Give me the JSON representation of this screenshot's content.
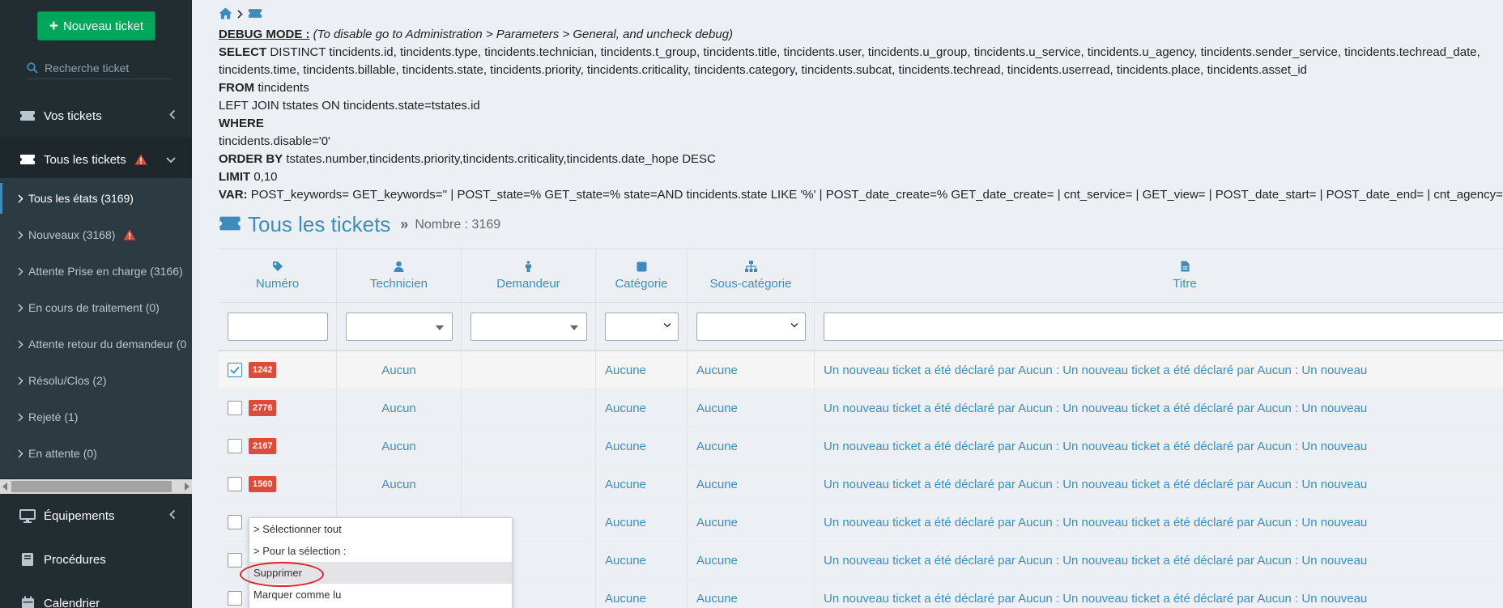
{
  "sidebar": {
    "new_ticket": "Nouveau ticket",
    "search_placeholder": "Recherche ticket",
    "menu": {
      "vos_tickets": "Vos tickets",
      "tous_tickets": "Tous les tickets",
      "equipements": "Équipements",
      "procedures": "Procédures",
      "calendrier": "Calendrier"
    },
    "sub": [
      "Tous les états (3169)",
      "Nouveaux (3168)",
      "Attente Prise en charge (3166)",
      "En cours de traitement (0)",
      "Attente retour du demandeur (0",
      "Résolu/Clos (2)",
      "Rejeté (1)",
      "En attente (0)"
    ]
  },
  "debug": {
    "title": "DEBUG MODE :",
    "note": "(To disable go to Administration > Parameters > General, and uncheck debug)",
    "select_kw": "SELECT",
    "select_1": "DISTINCT tincidents.id, tincidents.type, tincidents.technician, tincidents.t_group, tincidents.title, tincidents.user, tincidents.u_group, tincidents.u_service, tincidents.u_agency, tincidents.sender_service, tincidents.techread_date,",
    "select_2": "tincidents.time, tincidents.billable, tincidents.state, tincidents.priority, tincidents.criticality, tincidents.category, tincidents.subcat, tincidents.techread, tincidents.userread, tincidents.place, tincidents.asset_id",
    "from_kw": "FROM",
    "from_val": "tincidents",
    "join": "LEFT JOIN tstates ON tincidents.state=tstates.id",
    "where_kw": "WHERE",
    "where_val": "tincidents.disable='0'",
    "order_kw": "ORDER BY",
    "order_val": "tstates.number,tincidents.priority,tincidents.criticality,tincidents.date_hope DESC",
    "limit_kw": "LIMIT",
    "limit_val": "0,10",
    "var_kw": "VAR:",
    "var_val": "POST_keywords= GET_keywords='' | POST_state=% GET_state=% state=AND tincidents.state LIKE '%' | POST_date_create=% GET_date_create= | cnt_service= | GET_view= | POST_date_start= | POST_date_end= | cnt_agency="
  },
  "page": {
    "title": "Tous les tickets",
    "count": "Nombre : 3169"
  },
  "table": {
    "headers": {
      "numero": "Numéro",
      "technicien": "Technicien",
      "demandeur": "Demandeur",
      "categorie": "Catégorie",
      "souscat": "Sous-catégorie",
      "titre": "Titre"
    },
    "rows": [
      {
        "id": "1242",
        "tech": "Aucun",
        "cat": "Aucune",
        "sub": "Aucune",
        "title": "Un nouveau ticket a été déclaré par Aucun : Un nouveau ticket a été déclaré par Aucun : Un nouveau"
      },
      {
        "id": "2776",
        "tech": "Aucun",
        "cat": "Aucune",
        "sub": "Aucune",
        "title": "Un nouveau ticket a été déclaré par Aucun : Un nouveau ticket a été déclaré par Aucun : Un nouveau"
      },
      {
        "id": "2167",
        "tech": "Aucun",
        "cat": "Aucune",
        "sub": "Aucune",
        "title": "Un nouveau ticket a été déclaré par Aucun : Un nouveau ticket a été déclaré par Aucun : Un nouveau"
      },
      {
        "id": "1560",
        "tech": "Aucun",
        "cat": "Aucune",
        "sub": "Aucune",
        "title": "Un nouveau ticket a été déclaré par Aucun : Un nouveau ticket a été déclaré par Aucun : Un nouveau"
      },
      {
        "id": "",
        "tech": "",
        "cat": "Aucune",
        "sub": "Aucune",
        "title": "Un nouveau ticket a été déclaré par Aucun : Un nouveau ticket a été déclaré par Aucun : Un nouveau"
      },
      {
        "id": "",
        "tech": "",
        "cat": "Aucune",
        "sub": "Aucune",
        "title": "Un nouveau ticket a été déclaré par Aucun : Un nouveau ticket a été déclaré par Aucun : Un nouveau"
      },
      {
        "id": "",
        "tech": "",
        "cat": "Aucune",
        "sub": "Aucune",
        "title": "Un nouveau ticket a été déclaré par Aucun : Un nouveau ticket a été déclaré par Aucun : Un nouveau"
      }
    ]
  },
  "context_menu": {
    "select_all": "> Sélectionner tout",
    "for_selection": "> Pour la sélection :",
    "delete": "Supprimer",
    "mark_read": "Marquer comme lu"
  },
  "colors": {
    "sidebar_bg": "#222d32",
    "accent": "#3c8dbc",
    "success": "#00a65a",
    "danger": "#dd4b39"
  }
}
